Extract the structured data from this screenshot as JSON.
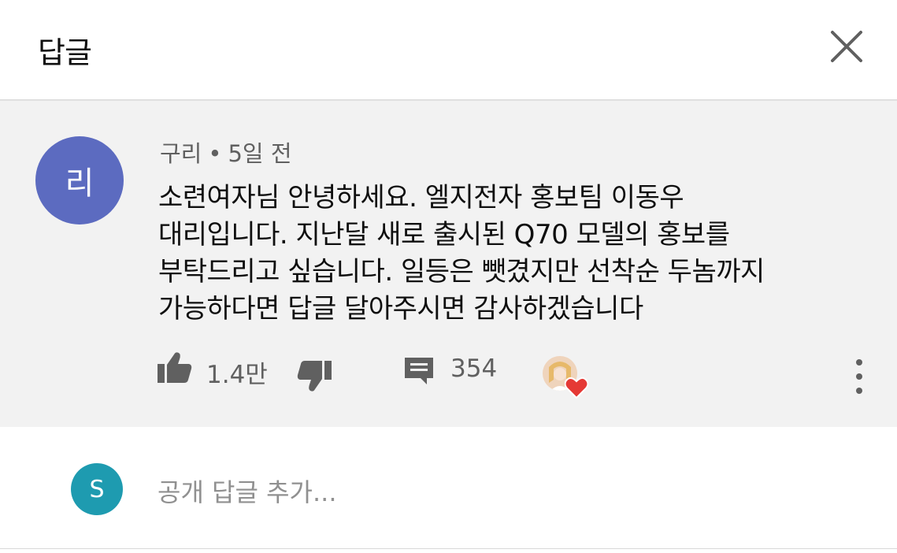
{
  "header": {
    "title": "답글"
  },
  "comment": {
    "avatar_letter": "리",
    "avatar_color": "#5c6bc0",
    "author": "구리",
    "separator": "•",
    "time": "5일 전",
    "text_lines": [
      "소련여자님 안녕하세요. 엘지전자 홍보팀 이동우",
      "대리입니다. 지난달 새로 출시된 Q70 모델의 홍보를",
      "부탁드리고 싶습니다. 일등은 뺏겼지만 선착순 두놈까지",
      "가능하다면 답글 달아주시면 감사하겠습니다"
    ],
    "likes": "1.4만",
    "replies": "354",
    "heart_color": "#e53935"
  },
  "add_reply": {
    "avatar_letter": "S",
    "avatar_color": "#1e9bb0",
    "placeholder": "공개 답글 추가..."
  }
}
